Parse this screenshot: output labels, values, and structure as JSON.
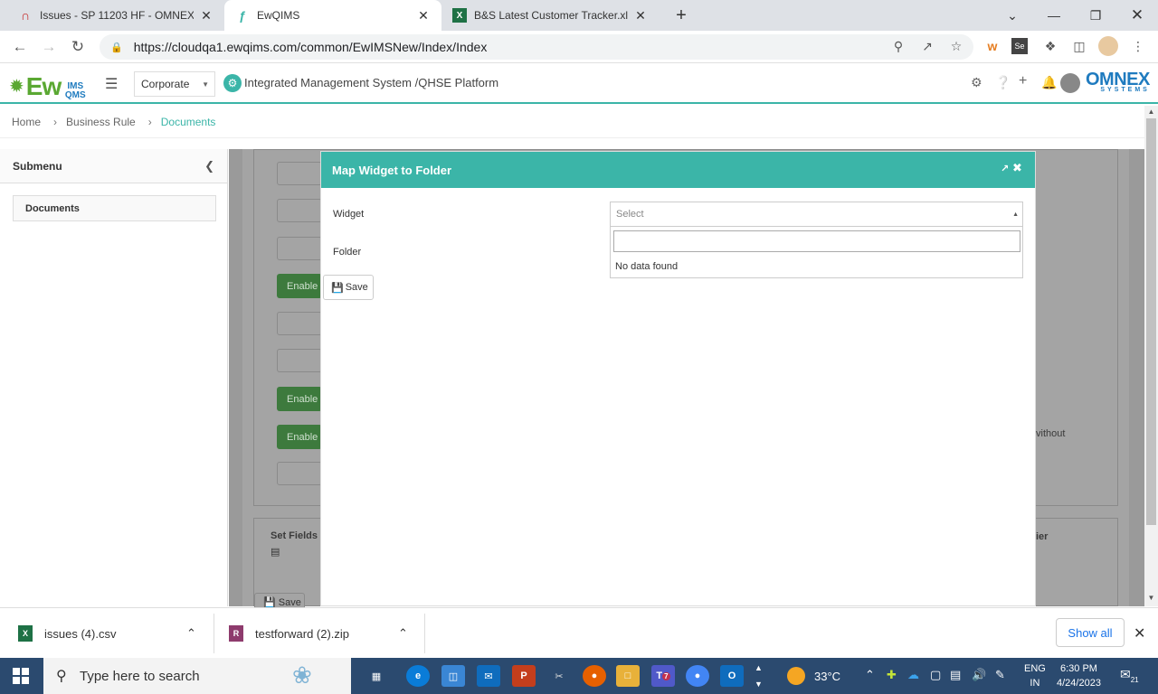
{
  "browser": {
    "tabs": [
      {
        "title": "Issues - SP 11203 HF - OMNEX IS",
        "icon": "omnex-issue-icon"
      },
      {
        "title": "EwQIMS",
        "icon": "ewqims-icon"
      },
      {
        "title": "B&S Latest Customer Tracker.xlsx",
        "icon": "excel-icon"
      }
    ],
    "url": "https://cloudqa1.ewqims.com/common/EwIMSNew/Index/Index"
  },
  "app": {
    "logo_text": "Ew",
    "logo_suffix": "IMS QMS",
    "org_select": "Corporate",
    "platform_title": "Integrated Management System /QHSE Platform",
    "brand": "OMNEX",
    "brand_sub": "SYSTEMS"
  },
  "breadcrumb": {
    "items": [
      "Home",
      "Business Rule",
      "Documents"
    ]
  },
  "submenu": {
    "title": "Submenu",
    "items": [
      "Documents"
    ]
  },
  "background": {
    "enable_label": "Enable",
    "set_fields": "Set Fields",
    "without_text": "vithout",
    "ier_text": "ier",
    "save_label": "Save"
  },
  "modal": {
    "title": "Map Widget to Folder",
    "widget_label": "Widget",
    "folder_label": "Folder",
    "select_placeholder": "Select",
    "no_data": "No data found",
    "save_label": "Save"
  },
  "downloads": [
    {
      "name": "issues (4).csv"
    },
    {
      "name": "testforward (2).zip"
    }
  ],
  "downloads_show_all": "Show all",
  "taskbar": {
    "search_placeholder": "Type here to search",
    "weather": "33°C",
    "lang_top": "ENG",
    "lang_bottom": "IN",
    "time": "6:30 PM",
    "date": "4/24/2023",
    "notifications": "21",
    "teams_badge": "7"
  },
  "colors": {
    "accent": "#3bb5a8",
    "enable_green": "#4caf50",
    "brand_blue": "#1f7bbf"
  }
}
